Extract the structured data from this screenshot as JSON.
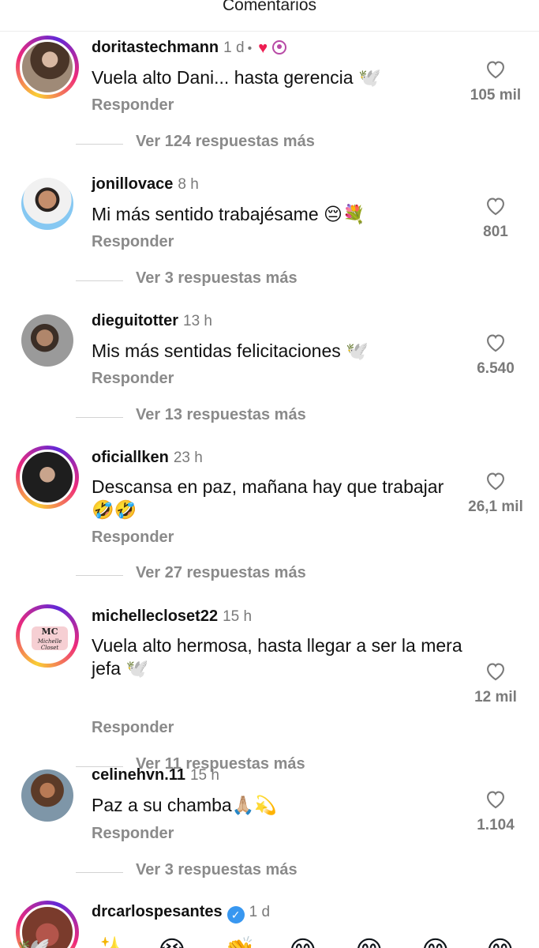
{
  "header": {
    "title": "Comentarios"
  },
  "comments": [
    {
      "username": "doritastechmann",
      "time": "1 d",
      "separator": "•",
      "badges": [
        "heart-red-icon",
        "creator-badge-icon"
      ],
      "text": "Vuela alto Dani... hasta gerencia 🕊️",
      "reply_label": "Responder",
      "likes": "105 mil",
      "more_replies": "Ver 124 respuestas más"
    },
    {
      "username": "jonillovace",
      "time": "8 h",
      "text": "Mi más sentido trabajésame 😔💐",
      "reply_label": "Responder",
      "likes": "801",
      "more_replies": "Ver 3 respuestas más"
    },
    {
      "username": "dieguitotter",
      "time": "13 h",
      "text": "Mis más sentidas felicitaciones 🕊️",
      "reply_label": "Responder",
      "likes": "6.540",
      "more_replies": "Ver 13 respuestas más"
    },
    {
      "username": "oficiallken",
      "time": "23 h",
      "text": "Descansa en paz, mañana hay que trabajar 🤣🤣",
      "reply_label": "Responder",
      "likes": "26,1 mil",
      "more_replies": "Ver 27 respuestas más"
    },
    {
      "username": "michellecloset22",
      "time": "15 h",
      "avatar_logo": {
        "initials": "MC",
        "script": "Michelle Closet"
      },
      "text": "Vuela alto hermosa, hasta llegar a ser la mera jefa 🕊️",
      "reply_label": "Responder",
      "likes": "12 mil",
      "more_replies": "Ver 11 respuestas más"
    },
    {
      "username": "celinehvn.11",
      "time": "15 h",
      "text": "Paz a su chamba🙏🏼💫",
      "reply_label": "Responder",
      "likes": "1.104",
      "more_replies": "Ver 3 respuestas más"
    },
    {
      "username": "drcarlospesantes",
      "time": "1 d",
      "verified_icon": "verified-check-icon"
    }
  ],
  "quick_reactions": [
    "🕊️",
    "✨",
    "😭",
    "👏",
    "😊",
    "😊",
    "😊",
    "😊"
  ],
  "colors": {
    "story_ring_start": "#f9ce34",
    "story_ring_mid": "#ee2a7b",
    "story_ring_end": "#6228d7",
    "like_heart_red": "#ee1d52",
    "verified_blue": "#3897f0",
    "secondary_text": "#8a8a8a"
  }
}
